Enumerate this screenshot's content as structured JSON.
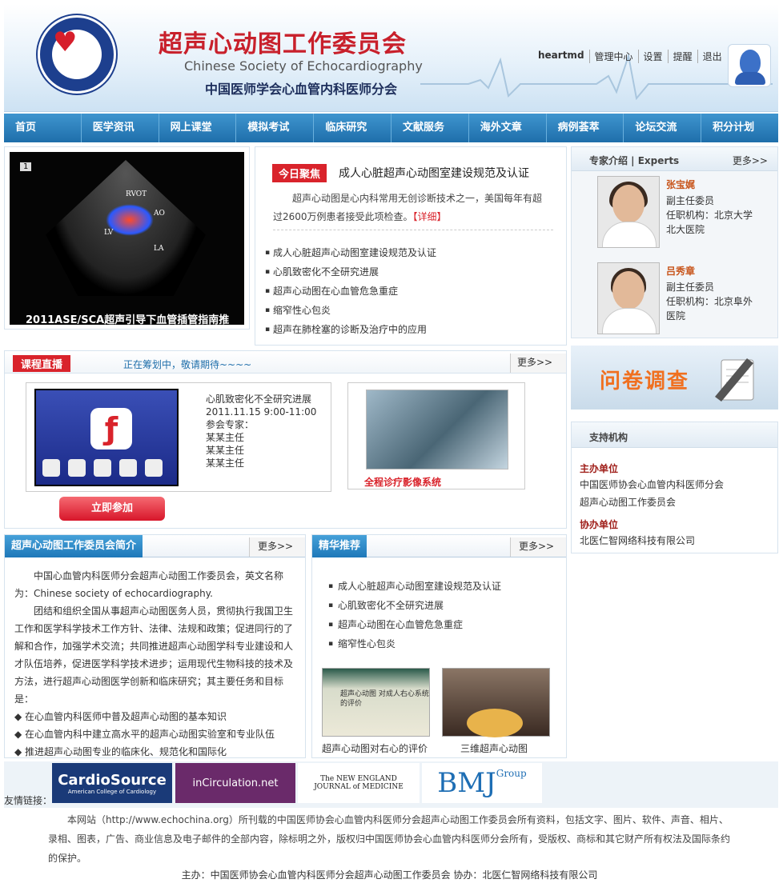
{
  "header": {
    "site_cn": "超声心动图工作委员会",
    "site_en": "Chinese Society of Echocardiography",
    "site_sub": "中国医师学会心血管内科医师分会",
    "user": "heartmd",
    "links": [
      "管理中心",
      "设置",
      "提醒",
      "退出"
    ]
  },
  "nav": [
    "首页",
    "医学资讯",
    "网上课堂",
    "模拟考试",
    "临床研究",
    "文献服务",
    "海外文章",
    "病例荟萃",
    "论坛交流",
    "积分计划"
  ],
  "slide": {
    "caption": "2011ASE/SCA超声引导下血管插管指南推",
    "index": "1",
    "labels": [
      "RVOT",
      "AO",
      "LV",
      "LA"
    ]
  },
  "focus": {
    "tag": "今日聚焦",
    "title": "成人心脏超声心动图室建设规范及认证",
    "desc": "超声心动图是心内科常用无创诊断技术之一，美国每年有超过2600万例患者接受此项检查。",
    "detail": "【详细】",
    "items": [
      "成人心脏超声心动图室建设规范及认证",
      "心肌致密化不全研究进展",
      "超声心动图在心血管危急重症",
      "缩窄性心包炎",
      "超声在肺栓塞的诊断及治疗中的应用"
    ]
  },
  "experts": {
    "title": "专家介绍 | Experts",
    "more": "更多>>",
    "list": [
      {
        "name": "张宝娓",
        "role": "副主任委员",
        "org": "任职机构：北京大学北大医院"
      },
      {
        "name": "吕秀章",
        "role": "副主任委员",
        "org": "任职机构：北京阜外医院"
      }
    ]
  },
  "survey": {
    "label": "问卷调查"
  },
  "support": {
    "title": "支持机构",
    "host_label": "主办单位",
    "hosts": [
      "中国医师协会心血管内科医师分会",
      "超声心动图工作委员会"
    ],
    "co_label": "协办单位",
    "co": [
      "北医仁智网络科技有限公司"
    ]
  },
  "live": {
    "tag": "课程直播",
    "note": "正在筹划中，敬请期待~~~~",
    "more": "更多>>",
    "title": "心肌致密化不全研究进展",
    "time": "2011.11.15 9:00-11:00",
    "experts_label": "参会专家：",
    "experts": [
      "某某主任",
      "某某主任",
      "某某主任"
    ],
    "image_caption": "全程诊疗影像系统",
    "join": "立即参加"
  },
  "intro": {
    "title": "超声心动图工作委员会简介",
    "more": "更多>>",
    "p1": "中国心血管内科医师分会超声心动图工作委员会，英文名称为：Chinese society of echocardiography.",
    "p2": "团结和组织全国从事超声心动图医务人员，贯彻执行我国卫生工作和医学科学技术工作方针、法律、法规和政策；促进同行的了解和合作，加强学术交流；共同推进超声心动图学科专业建设和人才队伍培养，促进医学科学技术进步；运用现代生物科技的技术及方法，进行超声心动图医学创新和临床研究；其主要任务和目标是：",
    "bullets": [
      "◆ 在心血管内科医师中普及超声心动图的基本知识",
      "◆ 在心血管内科中建立高水平的超声心动图实验室和专业队伍",
      "◆ 推进超声心动图专业的临床化、规范化和国际化"
    ]
  },
  "rec": {
    "title": "精华推荐",
    "more": "更多>>",
    "items": [
      "成人心脏超声心动图室建设规范及认证",
      "心肌致密化不全研究进展",
      "超声心动图在心血管危急重症",
      "缩窄性心包炎"
    ],
    "pic1_text": "超声心动图 对成人右心系统的评价",
    "cap1": "超声心动图对右心的评价",
    "cap2": "三维超声心动图"
  },
  "friends": {
    "label": "友情链接：",
    "logos": [
      "CardioSource",
      "American College of Cardiology",
      "inCirculation.net",
      "The NEW ENGLAND",
      "JOURNAL of MEDICINE",
      "BMJ",
      "Group"
    ]
  },
  "footer": {
    "copyright": "本网站（http://www.echochina.org）所刊载的中国医师协会心血管内科医师分会超声心动图工作委员会所有资料，包括文字、图片、软件、声音、相片、录相、图表，广告、商业信息及电子邮件的全部内容，除标明之外，版权归中国医师协会心血管内科医师分会所有，受版权、商标和其它财产所有权法及国际条约的保护。",
    "bottom": "主办：中国医师协会心血管内科医师分会超声心动图工作委员会 协办：北医仁智网络科技有限公司"
  }
}
